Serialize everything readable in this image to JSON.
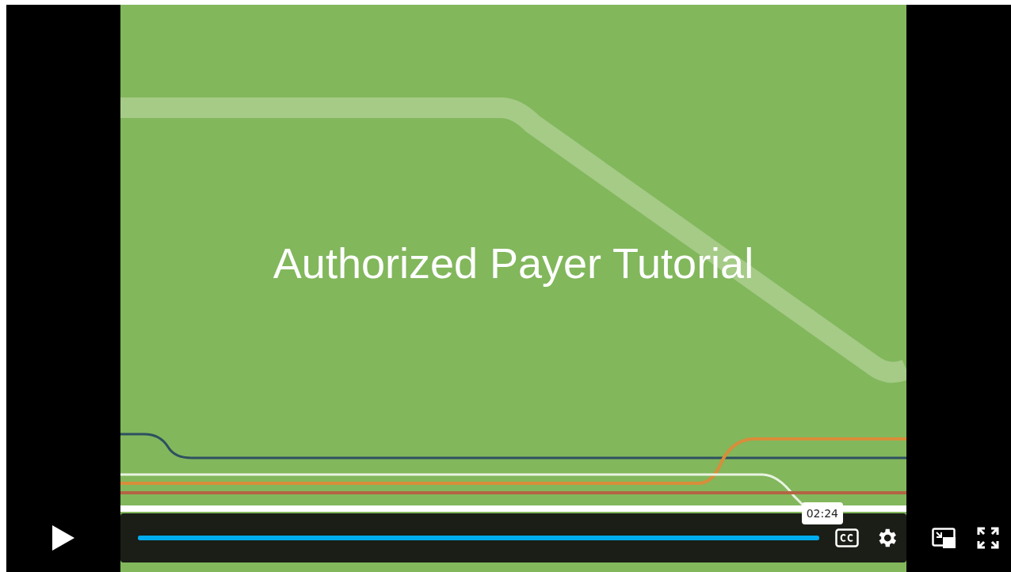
{
  "video": {
    "slide_title": "Authorized Payer Tutorial"
  },
  "controls": {
    "playing": false,
    "progress": {
      "level": 1
    },
    "tooltip": "02:24"
  }
}
